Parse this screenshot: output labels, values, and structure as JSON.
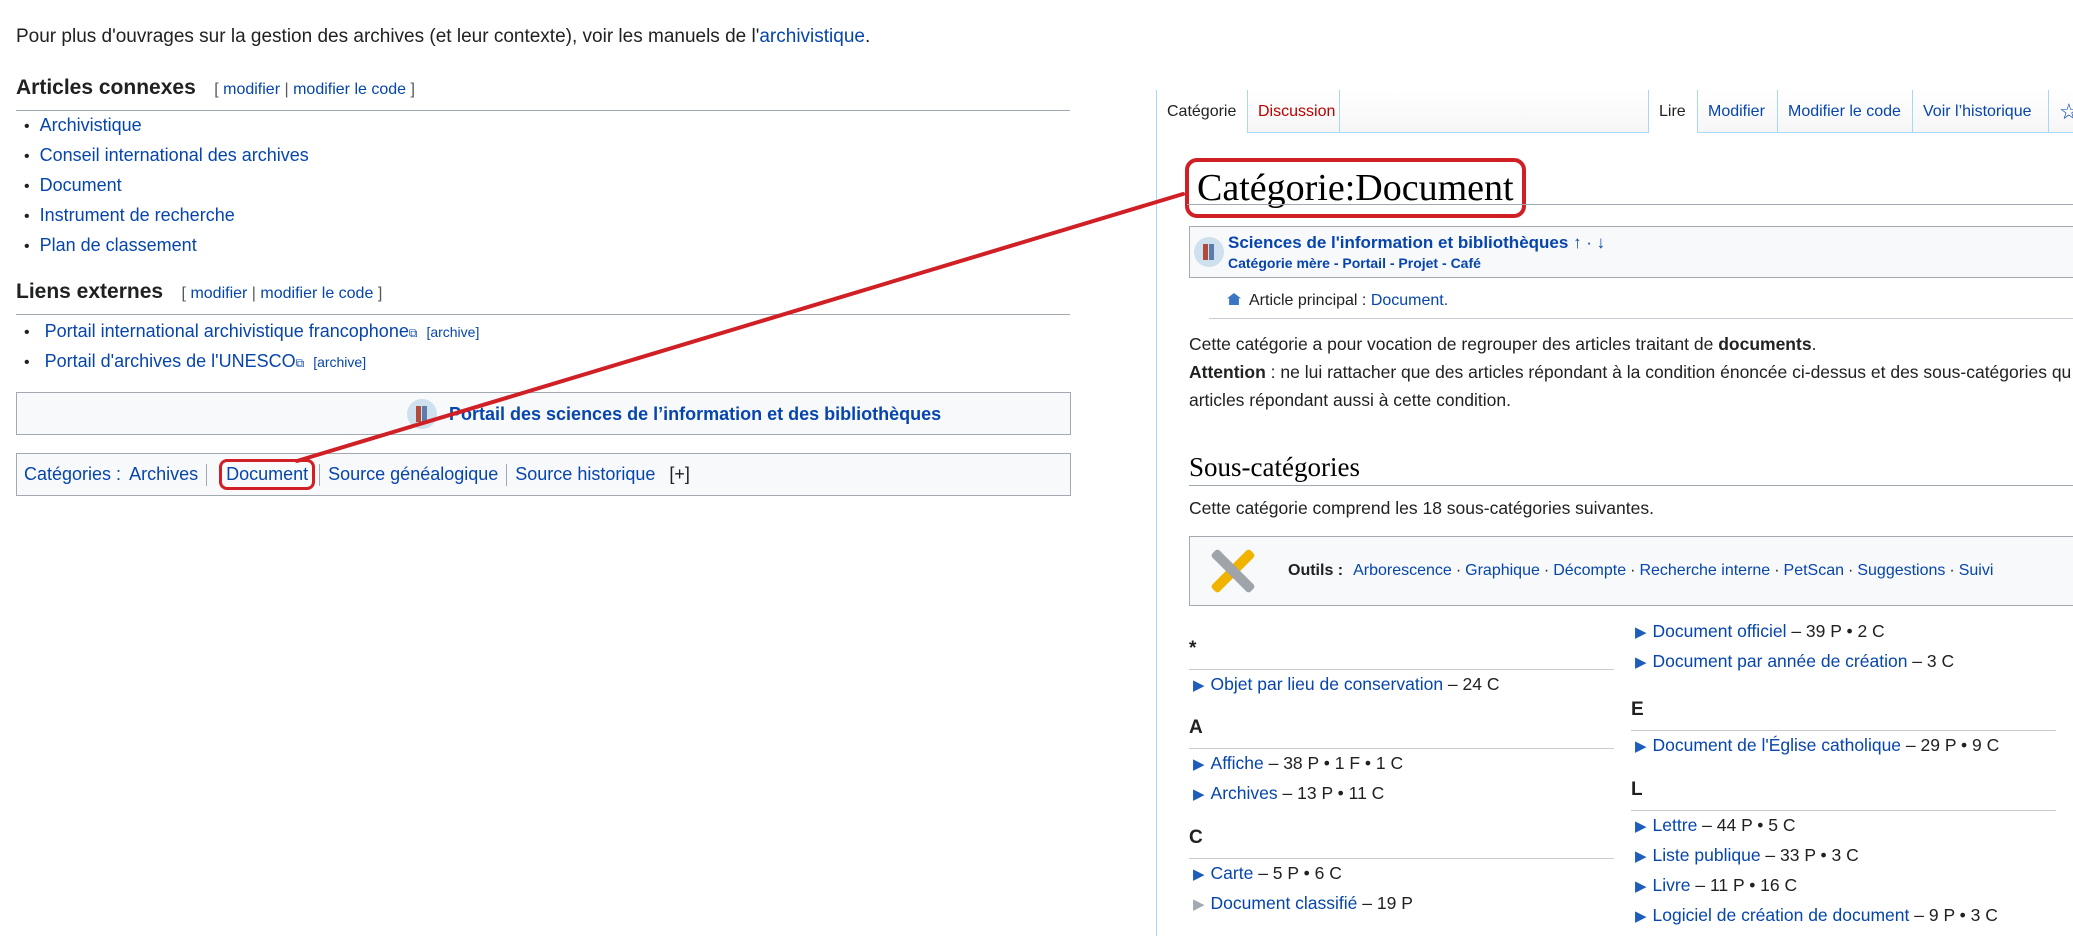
{
  "left": {
    "intro": {
      "prefix": "Pour plus d'ouvrages sur la gestion des archives (et leur contexte), voir les manuels de l'",
      "link": "archivistique",
      "suffix": "."
    },
    "related": {
      "heading": "Articles connexes",
      "edit_open": "[",
      "edit": "modifier",
      "edit_sep": "|",
      "edit_code": "modifier le code",
      "edit_close": "]",
      "items": [
        "Archivistique",
        "Conseil international des archives",
        "Document",
        "Instrument de recherche",
        "Plan de classement"
      ]
    },
    "external": {
      "heading": "Liens externes",
      "edit_open": "[",
      "edit": "modifier",
      "edit_sep": "|",
      "edit_code": "modifier le code",
      "edit_close": "]",
      "items": [
        {
          "label": "Portail international archivistique francophone",
          "icon": "external-link-icon",
          "archive": "[archive]"
        },
        {
          "label": "Portail d'archives de l'UNESCO",
          "icon": "external-link-icon",
          "archive": "[archive]"
        }
      ]
    },
    "portal": {
      "label": "Portail des sciences de l’information et des bibliothèques",
      "icon": "library-books-icon"
    },
    "categories": {
      "label": "Catégories :",
      "items": [
        "Archives",
        "Document",
        "Source généalogique",
        "Source historique"
      ],
      "expand": "[+]"
    }
  },
  "right": {
    "tabs": {
      "left": [
        "Catégorie",
        "Discussion"
      ],
      "right": [
        "Lire",
        "Modifier",
        "Modifier le code",
        "Voir l’historique"
      ],
      "watch_icon": "star-icon"
    },
    "title": "Catégorie:Document",
    "parent": {
      "name": "Sciences de l'information et bibliothèques",
      "arrows": "↑ · ↓",
      "links": [
        "Catégorie mère",
        "Portail",
        "Projet",
        "Café"
      ],
      "links_sep": " - "
    },
    "main_article": {
      "label": "Article principal : ",
      "link": "Document",
      "suffix": "."
    },
    "description": {
      "prefix": "Cette catégorie a pour vocation de regrouper des articles traitant de ",
      "bold": "documents",
      "suffix": "."
    },
    "attention": {
      "bold": "Attention",
      "line1": " : ne lui rattacher que des articles répondant à la condition énoncée ci-dessus et des sous-catégories qu",
      "line2": "articles répondant aussi à cette condition."
    },
    "subcats": {
      "heading": "Sous-catégories",
      "count_text": "Cette catégorie comprend les 18 sous-catégories suivantes.",
      "tools_label": "Outils :",
      "tools": [
        "Arborescence",
        "Graphique",
        "Décompte",
        "Recherche interne",
        "PetScan",
        "Suggestions",
        "Suivi"
      ],
      "col1": [
        {
          "letter": "*",
          "entries": [
            {
              "name": "Objet par lieu de conservation",
              "count": " – 24 C",
              "grey": false
            }
          ]
        },
        {
          "letter": "A",
          "entries": [
            {
              "name": "Affiche",
              "count": " – 38 P • 1 F • 1 C",
              "grey": false
            },
            {
              "name": "Archives",
              "count": " – 13 P • 11 C",
              "grey": false
            }
          ]
        },
        {
          "letter": "C",
          "entries": [
            {
              "name": "Carte",
              "count": " – 5 P • 6 C",
              "grey": false
            },
            {
              "name": "Document classifié",
              "count": " – 19 P",
              "grey": true
            }
          ]
        }
      ],
      "col2_top": [
        {
          "name": "Document officiel",
          "count": " – 39 P • 2 C",
          "grey": false
        },
        {
          "name": "Document par année de création",
          "count": " – 3 C",
          "grey": false
        }
      ],
      "col2": [
        {
          "letter": "E",
          "entries": [
            {
              "name": "Document de l'Église catholique",
              "count": " – 29 P • 9 C",
              "grey": false
            }
          ]
        },
        {
          "letter": "L",
          "entries": [
            {
              "name": "Lettre",
              "count": " – 44 P • 5 C",
              "grey": false
            },
            {
              "name": "Liste publique",
              "count": " – 33 P • 3 C",
              "grey": false
            },
            {
              "name": "Livre",
              "count": " – 11 P • 16 C",
              "grey": false
            },
            {
              "name": "Logiciel de création de document",
              "count": " – 9 P • 3 C",
              "grey": false
            }
          ]
        }
      ]
    }
  },
  "colors": {
    "link": "#0645ad",
    "highlight": "#d11f26",
    "border": "#a2a9b1",
    "tab_border": "#a7d7f9"
  }
}
